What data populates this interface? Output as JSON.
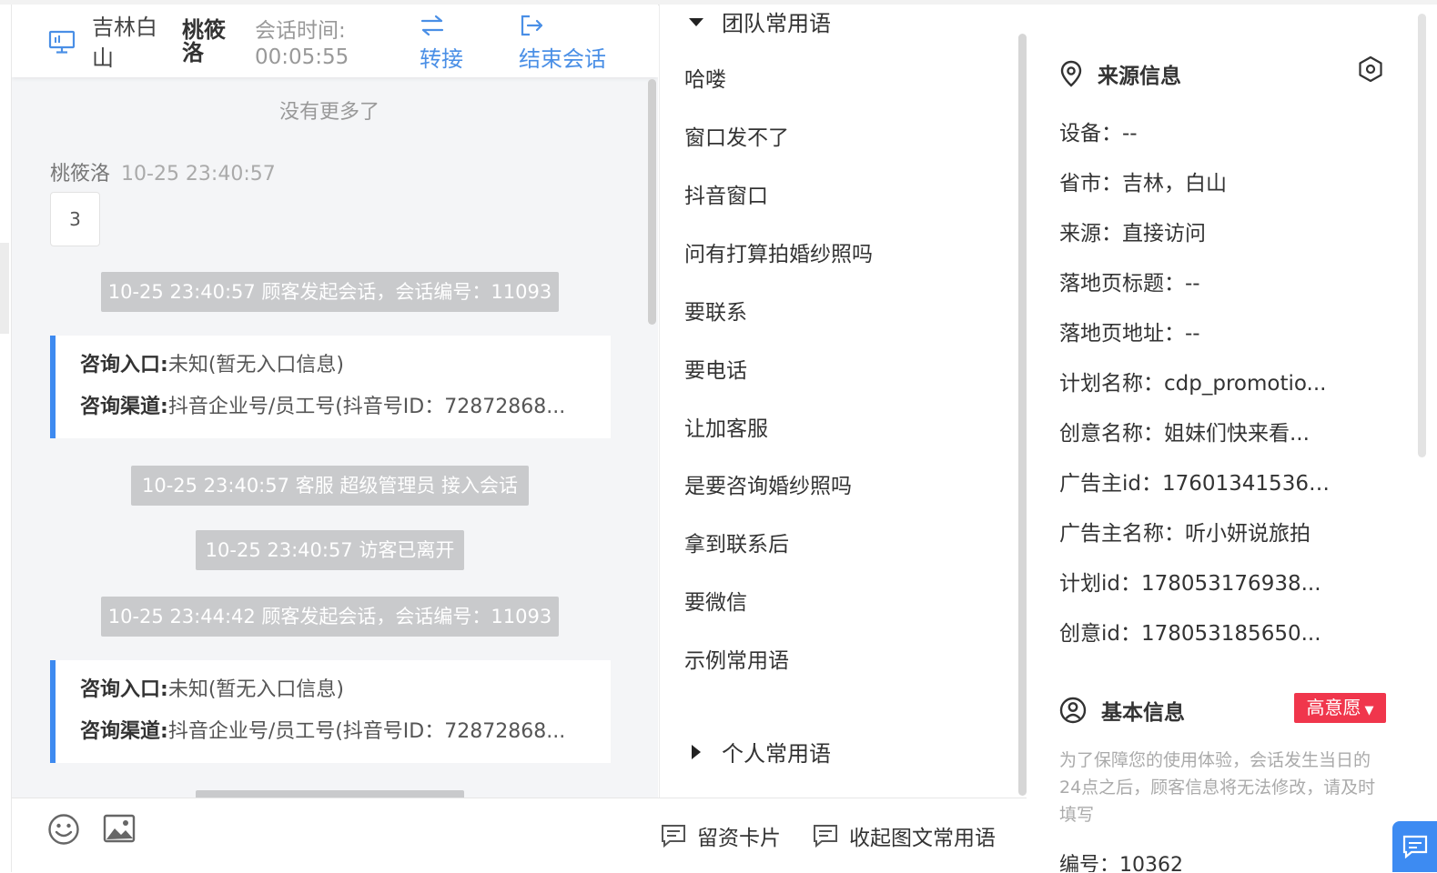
{
  "header": {
    "location": "吉林白山",
    "visitor_name": "桃筱洛",
    "session_time_label": "会话时间:",
    "session_time": "00:05:55",
    "transfer_label": "转接",
    "end_session_label": "结束会话"
  },
  "chat": {
    "no_more": "没有更多了",
    "message": {
      "sender": "桃筱洛",
      "time": "10-25 23:40:57",
      "text": "3"
    },
    "system_1": "10-25 23:40:57 顾客发起会话，会话编号：11093",
    "card_1": {
      "entry_label": "咨询入口:",
      "entry_value": "未知(暂无入口信息)",
      "channel_label": "咨询渠道:",
      "channel_value": "抖音企业号/员工号(抖音号ID：72872868..."
    },
    "system_2": "10-25 23:40:57 客服 超级管理员 接入会话",
    "system_3": "10-25 23:40:57 访客已离开",
    "system_4": "10-25 23:44:42 顾客发起会话，会话编号：11093",
    "card_2": {
      "entry_label": "咨询入口:",
      "entry_value": "未知(暂无入口信息)",
      "channel_label": "咨询渠道:",
      "channel_value": "抖音企业号/员工号(抖音号ID：72872868..."
    }
  },
  "footer": {
    "emoji_icon": "smiley-icon",
    "image_icon": "image-icon",
    "lead_card_label": "留资卡片",
    "collapse_label": "收起图文常用语"
  },
  "phrases": {
    "team_group": "团队常用语",
    "items": [
      "哈喽",
      "窗口发不了",
      "抖音窗口",
      "问有打算拍婚纱照吗",
      "要联系",
      "要电话",
      "让加客服",
      "是要咨询婚纱照吗",
      "拿到联系后",
      "要微信",
      "示例常用语"
    ],
    "personal_group": "个人常用语"
  },
  "source_info": {
    "title": "来源信息",
    "rows": [
      "设备：--",
      "省市：吉林，白山",
      "来源：直接访问",
      "落地页标题：--",
      "落地页地址：--",
      "计划名称：cdp_promotio...",
      "创意名称：姐妹们快来看...",
      "广告主id：176013415361...",
      "广告主名称：听小妍说旅拍",
      "计划id：178053176938...",
      "创意id：178053185650..."
    ]
  },
  "basic_info": {
    "title": "基本信息",
    "intent_tag": "高意愿",
    "notice": "为了保障您的使用体验，会话发生当日的24点之后，顾客信息将无法修改，请及时填写",
    "number_row": "编号：10362"
  },
  "colors": {
    "accent": "#4a8fe6",
    "card_border": "#3e8af0",
    "tag_red": "#f0364c",
    "system_bg": "#c9cacc"
  }
}
